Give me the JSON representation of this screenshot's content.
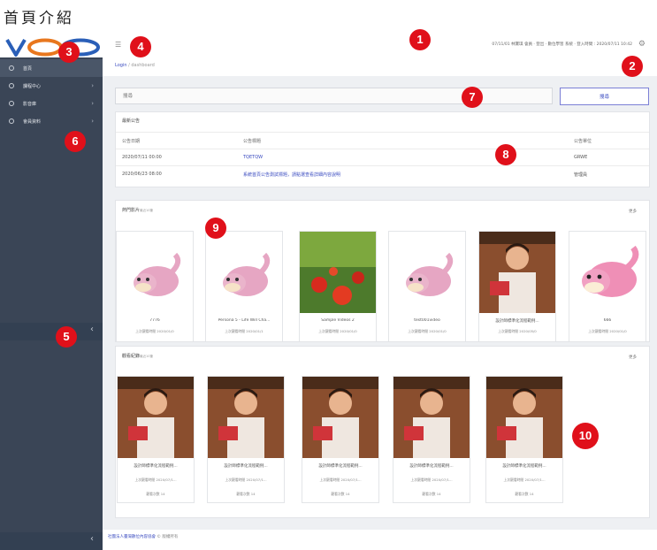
{
  "page_heading": "首頁介紹",
  "logo_text": "VOD",
  "colors": {
    "sidebar": "#3a4556",
    "accent": "#3b4cc0",
    "marker": "#e0101a"
  },
  "header": {
    "user_info": "07/11/01 林寶琪 會員 · 登出 · 數位學習 系統 · 登入時間 : 2020/07/11 10:42",
    "settings_icon": "gear-icon",
    "menu_icon": "hamburger-icon"
  },
  "breadcrumb": {
    "root": "Login",
    "separator": " / ",
    "current": "dashboard"
  },
  "sidebar": {
    "items": [
      {
        "label": "首頁",
        "icon": "home-icon"
      },
      {
        "label": "課程中心",
        "icon": "course-icon",
        "has_children": true
      },
      {
        "label": "影音庫",
        "icon": "video-icon",
        "has_children": true
      },
      {
        "label": "會員資料",
        "icon": "user-icon",
        "has_children": true
      }
    ],
    "collapse_arrow": "‹"
  },
  "search": {
    "placeholder": "搜尋",
    "button_label": "搜尋"
  },
  "announcements": {
    "title": "最新公告",
    "columns": [
      "公告日期",
      "公告標題",
      "公告單位"
    ],
    "rows": [
      {
        "date": "2020/07/11 00:00",
        "title": "TQETQW",
        "unit": "GRWE"
      },
      {
        "date": "2020/06/23 08:00",
        "title": "系統首頁公告測試標題，請點選查看詳細內容說明",
        "unit": "管理員"
      }
    ]
  },
  "recommended": {
    "title": "熱門影片",
    "subtitle": "最近10筆",
    "more": "更多",
    "videos": [
      {
        "title": "7776",
        "meta": "上次觀看時間 2020/01/0"
      },
      {
        "title": "Persona 5 - Life Will Cha...",
        "meta": "上次觀看時間 2020/01/1"
      },
      {
        "title": "Sample Videos 2",
        "meta": "上次觀看時間 2020/01/0"
      },
      {
        "title": "test001video",
        "meta": "上次觀看時間 2020/01/0"
      },
      {
        "title": "設計師標準化流程範例...",
        "meta": "上次觀看時間 2020/05/0"
      },
      {
        "title": "666",
        "meta": "上次觀看時間 2020/01/0"
      }
    ]
  },
  "history": {
    "title": "觀看紀錄",
    "subtitle": "最近10筆",
    "more": "更多",
    "videos": [
      {
        "title": "設計師標準化流程範例...",
        "meta": "上次觀看時間 2020/07/1...",
        "views": "觀看次數 14"
      },
      {
        "title": "設計師標準化流程範例...",
        "meta": "上次觀看時間 2020/07/1...",
        "views": "觀看次數 14"
      },
      {
        "title": "設計師標準化流程範例...",
        "meta": "上次觀看時間 2020/07/1...",
        "views": "觀看次數 14"
      },
      {
        "title": "設計師標準化流程範例...",
        "meta": "上次觀看時間 2020/07/1...",
        "views": "觀看次數 14"
      },
      {
        "title": "設計師標準化流程範例...",
        "meta": "上次觀看時間 2020/07/1...",
        "views": "觀看次數 14"
      }
    ]
  },
  "footer": {
    "org": "社團法人臺灣數位內容協會",
    "suffix": " © 版權所有"
  },
  "markers": [
    "1",
    "2",
    "3",
    "4",
    "5",
    "6",
    "7",
    "8",
    "9",
    "10"
  ]
}
